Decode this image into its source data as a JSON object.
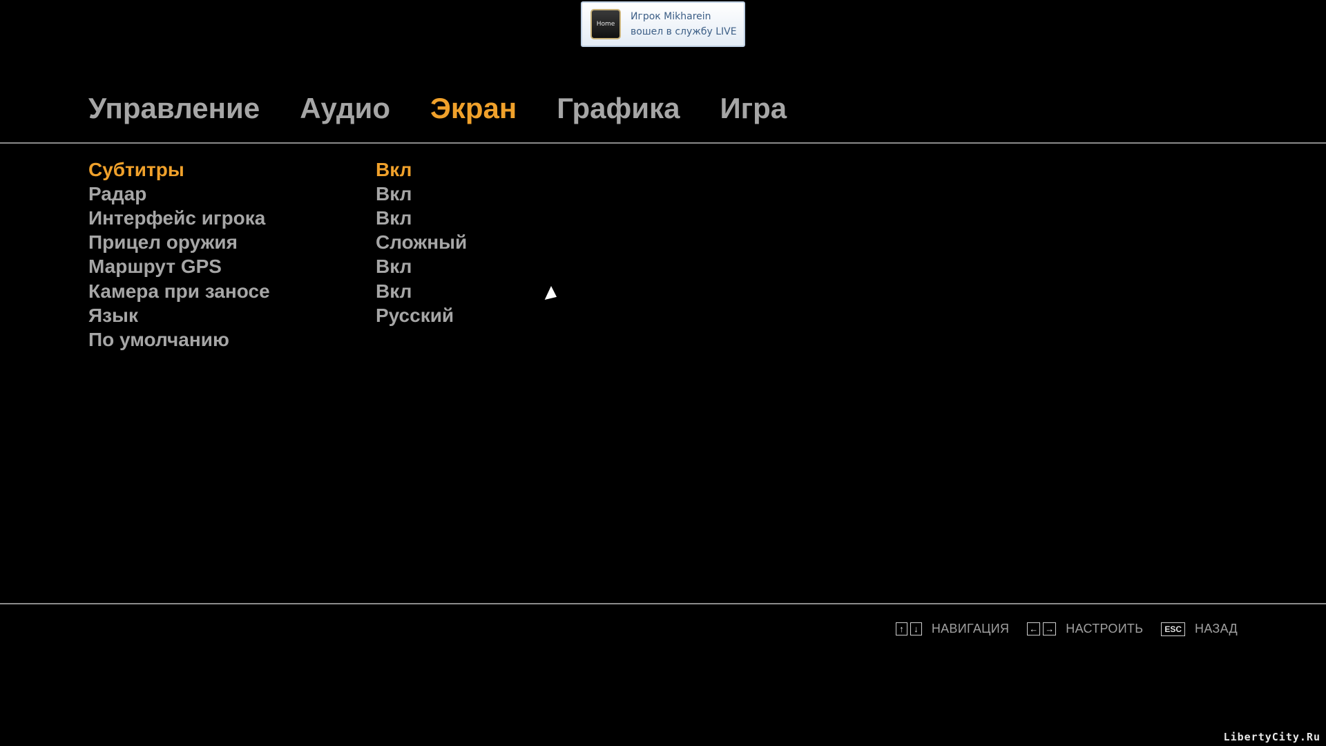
{
  "notification": {
    "icon_label": "Home",
    "line1": "Игрок Mikharein",
    "line2": "вошел в службу LIVE"
  },
  "tabs": [
    {
      "label": "Управление",
      "active": false
    },
    {
      "label": "Аудио",
      "active": false
    },
    {
      "label": "Экран",
      "active": true
    },
    {
      "label": "Графика",
      "active": false
    },
    {
      "label": "Игра",
      "active": false
    }
  ],
  "settings": [
    {
      "label": "Субтитры",
      "value": "Вкл",
      "selected": true
    },
    {
      "label": "Радар",
      "value": "Вкл",
      "selected": false
    },
    {
      "label": "Интерфейс игрока",
      "value": "Вкл",
      "selected": false
    },
    {
      "label": "Прицел оружия",
      "value": "Сложный",
      "selected": false
    },
    {
      "label": "Маршрут GPS",
      "value": "Вкл",
      "selected": false
    },
    {
      "label": "Камера при заносе",
      "value": "Вкл",
      "selected": false
    },
    {
      "label": "Язык",
      "value": "Русский",
      "selected": false
    },
    {
      "label": "По умолчанию",
      "value": "",
      "selected": false
    }
  ],
  "hints": {
    "navigate": {
      "keys": [
        "↑",
        "↓"
      ],
      "label": "НАВИГАЦИЯ"
    },
    "adjust": {
      "keys": [
        "←",
        "→"
      ],
      "label": "НАСТРОИТЬ"
    },
    "back": {
      "key": "ESC",
      "label": "НАЗАД"
    }
  },
  "watermark": "LibertyCity.Ru",
  "colors": {
    "accent": "#f0a12b",
    "text": "#a6a6a6",
    "background": "#000000"
  }
}
